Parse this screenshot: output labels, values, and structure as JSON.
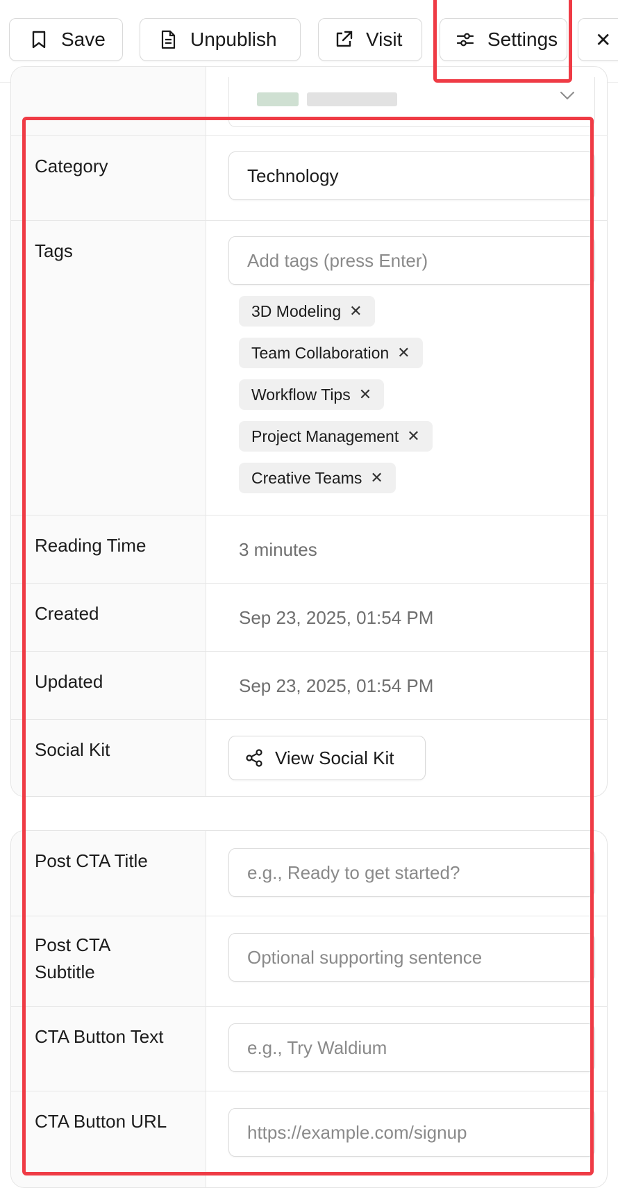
{
  "toolbar": {
    "save_label": "Save",
    "unpublish_label": "Unpublish",
    "visit_label": "Visit",
    "settings_label": "Settings",
    "close_glyph": "✕"
  },
  "fields": {
    "category_label": "Category",
    "category_value": "Technology",
    "tags_label": "Tags",
    "tags_placeholder": "Add tags (press Enter)",
    "tags": [
      "3D Modeling",
      "Team Collaboration",
      "Workflow Tips",
      "Project Management",
      "Creative Teams"
    ],
    "tag_remove_glyph": "✕",
    "reading_time_label": "Reading Time",
    "reading_time_value": "3 minutes",
    "created_label": "Created",
    "created_value": "Sep 23, 2025, 01:54 PM",
    "updated_label": "Updated",
    "updated_value": "Sep 23, 2025, 01:54 PM",
    "social_kit_label": "Social Kit",
    "social_kit_button": "View Social Kit"
  },
  "cta": {
    "title_label": "Post CTA Title",
    "title_placeholder": "e.g., Ready to get started?",
    "subtitle_label_line1": "Post CTA",
    "subtitle_label_line2": "Subtitle",
    "subtitle_placeholder": "Optional supporting sentence",
    "button_text_label": "CTA Button Text",
    "button_text_placeholder": "e.g., Try Waldium",
    "button_url_label": "CTA Button URL",
    "button_url_placeholder": "https://example.com/signup"
  },
  "colors": {
    "highlight": "#ef3b45",
    "label_column_bg": "#fafafa",
    "tag_bg": "#f0f0f0"
  }
}
